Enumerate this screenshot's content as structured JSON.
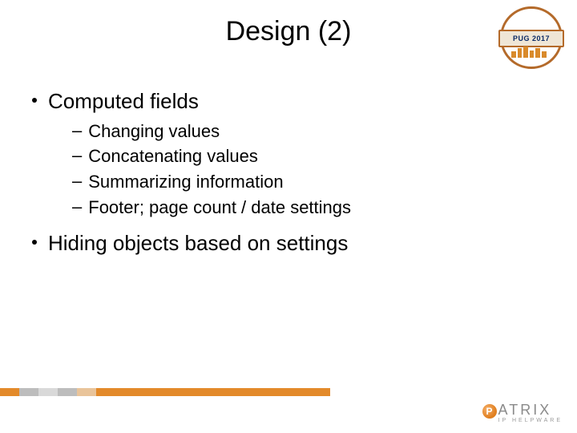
{
  "title": "Design (2)",
  "badge": {
    "label": "PUG 2017"
  },
  "bullets": [
    {
      "text": "Computed fields",
      "children": [
        "Changing values",
        "Concatenating values",
        "Summarizing information",
        "Footer; page count / date settings"
      ]
    },
    {
      "text": "Hiding objects based on settings",
      "children": []
    }
  ],
  "brand": {
    "name_rest": "ATRIX",
    "tagline": "IP HELPWARE"
  }
}
